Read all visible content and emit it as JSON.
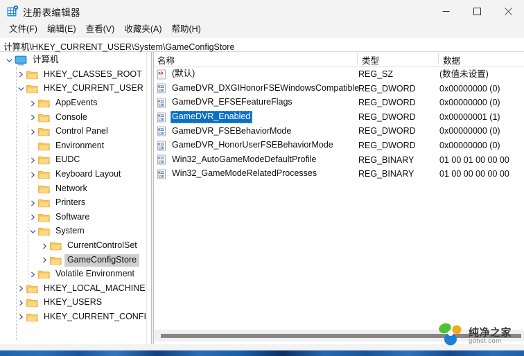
{
  "window": {
    "title": "注册表编辑器",
    "icon": "registry-editor-icon",
    "minimize_label": "–",
    "maximize_label": "□",
    "close_label": "✕"
  },
  "menubar": {
    "items": [
      {
        "label": "文件(F)",
        "name": "menu-file"
      },
      {
        "label": "编辑(E)",
        "name": "menu-edit"
      },
      {
        "label": "查看(V)",
        "name": "menu-view"
      },
      {
        "label": "收藏夹(A)",
        "name": "menu-favorites"
      },
      {
        "label": "帮助(H)",
        "name": "menu-help"
      }
    ]
  },
  "address": {
    "path": "计算机\\HKEY_CURRENT_USER\\System\\GameConfigStore"
  },
  "tree": {
    "nodes": [
      {
        "label": "计算机",
        "depth": 0,
        "expander": "down",
        "icon": "computer-icon",
        "selected": false
      },
      {
        "label": "HKEY_CLASSES_ROOT",
        "depth": 1,
        "expander": "right",
        "icon": "folder-icon",
        "selected": false
      },
      {
        "label": "HKEY_CURRENT_USER",
        "depth": 1,
        "expander": "down",
        "icon": "folder-icon",
        "selected": false
      },
      {
        "label": "AppEvents",
        "depth": 2,
        "expander": "right",
        "icon": "folder-icon",
        "selected": false
      },
      {
        "label": "Console",
        "depth": 2,
        "expander": "right",
        "icon": "folder-icon",
        "selected": false
      },
      {
        "label": "Control Panel",
        "depth": 2,
        "expander": "right",
        "icon": "folder-icon",
        "selected": false
      },
      {
        "label": "Environment",
        "depth": 2,
        "expander": "none",
        "icon": "folder-icon",
        "selected": false
      },
      {
        "label": "EUDC",
        "depth": 2,
        "expander": "right",
        "icon": "folder-icon",
        "selected": false
      },
      {
        "label": "Keyboard Layout",
        "depth": 2,
        "expander": "right",
        "icon": "folder-icon",
        "selected": false
      },
      {
        "label": "Network",
        "depth": 2,
        "expander": "none",
        "icon": "folder-icon",
        "selected": false
      },
      {
        "label": "Printers",
        "depth": 2,
        "expander": "right",
        "icon": "folder-icon",
        "selected": false
      },
      {
        "label": "Software",
        "depth": 2,
        "expander": "right",
        "icon": "folder-icon",
        "selected": false
      },
      {
        "label": "System",
        "depth": 2,
        "expander": "down",
        "icon": "folder-icon",
        "selected": false
      },
      {
        "label": "CurrentControlSet",
        "depth": 3,
        "expander": "right",
        "icon": "folder-icon",
        "selected": false
      },
      {
        "label": "GameConfigStore",
        "depth": 3,
        "expander": "right",
        "icon": "folder-icon",
        "selected": true
      },
      {
        "label": "Volatile Environment",
        "depth": 2,
        "expander": "right",
        "icon": "folder-icon",
        "selected": false
      },
      {
        "label": "HKEY_LOCAL_MACHINE",
        "depth": 1,
        "expander": "right",
        "icon": "folder-icon",
        "selected": false
      },
      {
        "label": "HKEY_USERS",
        "depth": 1,
        "expander": "right",
        "icon": "folder-icon",
        "selected": false
      },
      {
        "label": "HKEY_CURRENT_CONFIG",
        "depth": 1,
        "expander": "right",
        "icon": "folder-icon",
        "selected": false
      }
    ]
  },
  "list": {
    "columns": [
      {
        "label": "名称",
        "name": "column-name"
      },
      {
        "label": "类型",
        "name": "column-type"
      },
      {
        "label": "数据",
        "name": "column-data"
      }
    ],
    "rows": [
      {
        "name": "(默认)",
        "type": "REG_SZ",
        "data": "(数值未设置)",
        "icon": "string-value-icon",
        "selected": false
      },
      {
        "name": "GameDVR_DXGIHonorFSEWindowsCompatible",
        "type": "REG_DWORD",
        "data": "0x00000000 (0)",
        "icon": "binary-value-icon",
        "selected": false
      },
      {
        "name": "GameDVR_EFSEFeatureFlags",
        "type": "REG_DWORD",
        "data": "0x00000000 (0)",
        "icon": "binary-value-icon",
        "selected": false
      },
      {
        "name": "GameDVR_Enabled",
        "type": "REG_DWORD",
        "data": "0x00000001 (1)",
        "icon": "binary-value-icon",
        "selected": true
      },
      {
        "name": "GameDVR_FSEBehaviorMode",
        "type": "REG_DWORD",
        "data": "0x00000000 (0)",
        "icon": "binary-value-icon",
        "selected": false
      },
      {
        "name": "GameDVR_HonorUserFSEBehaviorMode",
        "type": "REG_DWORD",
        "data": "0x00000000 (0)",
        "icon": "binary-value-icon",
        "selected": false
      },
      {
        "name": "Win32_AutoGameModeDefaultProfile",
        "type": "REG_BINARY",
        "data": "01 00 01 00 00 00",
        "icon": "binary-value-icon",
        "selected": false
      },
      {
        "name": "Win32_GameModeRelatedProcesses",
        "type": "REG_BINARY",
        "data": "01 00 00 00 00 00",
        "icon": "binary-value-icon",
        "selected": false
      }
    ]
  },
  "watermark": {
    "title": "纯净之家",
    "url": "gdhst.com"
  },
  "colors": {
    "selection_blue": "#0b6fc4",
    "tree_selection_gray": "#cfcfcf",
    "window_chrome": "#f3f3f3",
    "taskbar_blue": "#1d5fa8",
    "folder_yellow": "#fcc75e"
  }
}
